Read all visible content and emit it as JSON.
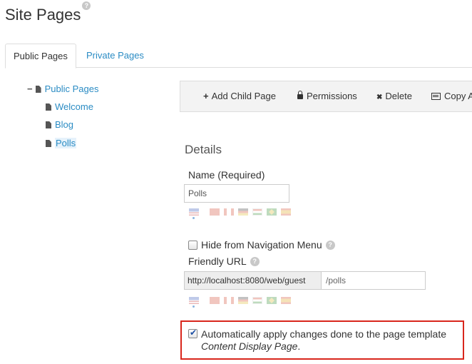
{
  "header": {
    "title": "Site Pages",
    "help": "?"
  },
  "tabs": [
    {
      "label": "Public Pages",
      "active": true
    },
    {
      "label": "Private Pages",
      "active": false
    }
  ],
  "tree": {
    "toggle": "−",
    "root": "Public Pages",
    "children": [
      "Welcome",
      "Blog",
      "Polls"
    ],
    "selected": "Polls"
  },
  "toolbar": {
    "add_child_page": "Add Child Page",
    "add_icon": "+",
    "permissions": "Permissions",
    "delete": "Delete",
    "delete_icon": "✖",
    "copy": "Copy A"
  },
  "details": {
    "title": "Details",
    "name_label": "Name (Required)",
    "name_value": "Polls",
    "hide_label": "Hide from Navigation Menu",
    "hide_checked": false,
    "friendly_url_label": "Friendly URL",
    "url_prefix": "http://localhost:8080/web/guest",
    "url_value": "/polls",
    "auto_apply_label": "Automatically apply changes done to the page template",
    "auto_apply_template": "Content Display Page",
    "auto_apply_suffix": ".",
    "auto_apply_checked": true,
    "help": "?"
  },
  "language_flags": [
    "us-flag-icon",
    "cn-flag-icon",
    "ca-flag-icon",
    "de-flag-icon",
    "hu-flag-icon",
    "br-flag-icon",
    "es-flag-icon"
  ],
  "colors": {
    "link": "#2b8cc4",
    "highlight_border": "#d9261c",
    "toolbar_bg": "#f3f3f3"
  }
}
